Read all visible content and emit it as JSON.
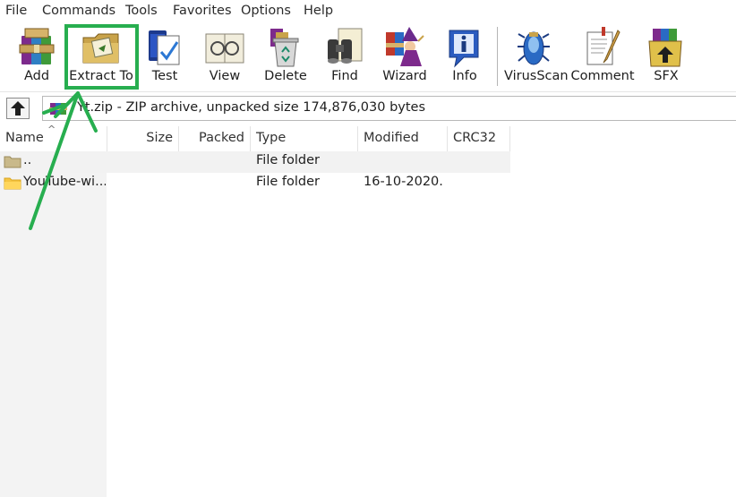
{
  "menubar": {
    "items": [
      {
        "label": "File"
      },
      {
        "label": "Commands"
      },
      {
        "label": "Tools"
      },
      {
        "label": "Favorites"
      },
      {
        "label": "Options"
      },
      {
        "label": "Help"
      }
    ]
  },
  "toolbar": {
    "buttons": [
      {
        "label": "Add",
        "icon": "add-archive-icon"
      },
      {
        "label": "Extract To",
        "icon": "extract-to-icon"
      },
      {
        "label": "Test",
        "icon": "test-icon"
      },
      {
        "label": "View",
        "icon": "view-glasses-icon"
      },
      {
        "label": "Delete",
        "icon": "delete-recycle-icon"
      },
      {
        "label": "Find",
        "icon": "find-binoculars-icon"
      },
      {
        "label": "Wizard",
        "icon": "wizard-icon"
      },
      {
        "label": "Info",
        "icon": "info-icon"
      },
      {
        "label": "VirusScan",
        "icon": "virusscan-icon"
      },
      {
        "label": "Comment",
        "icon": "comment-icon"
      },
      {
        "label": "SFX",
        "icon": "sfx-icon"
      }
    ]
  },
  "address": {
    "text": "Yt.zip - ZIP archive, unpacked size 174,876,030 bytes"
  },
  "file_list": {
    "columns": [
      "Name",
      "Size",
      "Packed",
      "Type",
      "Modified",
      "CRC32"
    ],
    "rows": [
      {
        "name": "..",
        "size": "",
        "packed": "",
        "type": "File folder",
        "modified": "",
        "crc32": ""
      },
      {
        "name": "YouTube-wi...",
        "size": "",
        "packed": "",
        "type": "File folder",
        "modified": "16-10-2020...",
        "crc32": ""
      }
    ]
  },
  "annotation": {
    "color": "#27ae4f"
  }
}
